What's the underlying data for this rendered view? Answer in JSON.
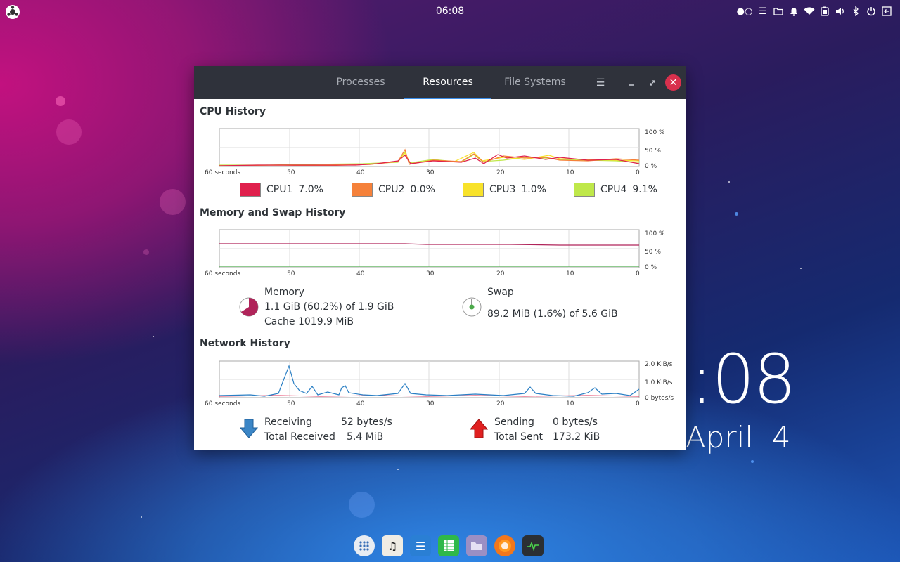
{
  "top_bar": {
    "clock": "06:08",
    "tray_icons": [
      "workspace-indicator",
      "menu-icon",
      "folder-icon",
      "bell-icon",
      "wifi-icon",
      "battery-icon",
      "volume-icon",
      "bluetooth-icon",
      "power-icon",
      "logout-icon"
    ]
  },
  "desktop": {
    "time": ":08",
    "date": "April  4"
  },
  "window": {
    "tabs": [
      {
        "label": "Processes"
      },
      {
        "label": "Resources",
        "active": true
      },
      {
        "label": "File Systems"
      }
    ],
    "cpu": {
      "title": "CPU History",
      "y_labels": [
        "100 %",
        "50 %",
        "0 %"
      ],
      "x_labels": [
        "60 seconds",
        "50",
        "40",
        "30",
        "20",
        "10",
        "0"
      ],
      "legend": [
        {
          "name": "CPU1",
          "value": "7.0%",
          "color": "#e0204d"
        },
        {
          "name": "CPU2",
          "value": "0.0%",
          "color": "#f5813a"
        },
        {
          "name": "CPU3",
          "value": "1.0%",
          "color": "#f8e22a"
        },
        {
          "name": "CPU4",
          "value": "9.1%",
          "color": "#bfe84a"
        }
      ]
    },
    "memory": {
      "title": "Memory and Swap History",
      "y_labels": [
        "100 %",
        "50 %",
        "0 %"
      ],
      "x_labels": [
        "60 seconds",
        "50",
        "40",
        "30",
        "20",
        "10",
        "0"
      ],
      "memory_label": "Memory",
      "memory_usage": "1.1 GiB (60.2%) of 1.9 GiB",
      "memory_cache": "Cache 1019.9 MiB",
      "memory_fraction": 0.602,
      "swap_label": "Swap",
      "swap_usage": "89.2 MiB (1.6%) of 5.6 GiB",
      "swap_fraction": 0.016
    },
    "network": {
      "title": "Network History",
      "y_labels": [
        "2.0 KiB/s",
        "1.0 KiB/s",
        "0 bytes/s"
      ],
      "x_labels": [
        "60 seconds",
        "50",
        "40",
        "30",
        "20",
        "10",
        "0"
      ],
      "receiving_label": "Receiving",
      "receiving_value": "52 bytes/s",
      "total_received_label": "Total Received",
      "total_received_value": "5.4 MiB",
      "sending_label": "Sending",
      "sending_value": "0 bytes/s",
      "total_sent_label": "Total Sent",
      "total_sent_value": "173.2 KiB"
    }
  },
  "dock": [
    "launcher-icon",
    "music-icon",
    "text-editor-icon",
    "spreadsheet-icon",
    "files-icon",
    "firefox-icon",
    "system-monitor-icon"
  ]
}
